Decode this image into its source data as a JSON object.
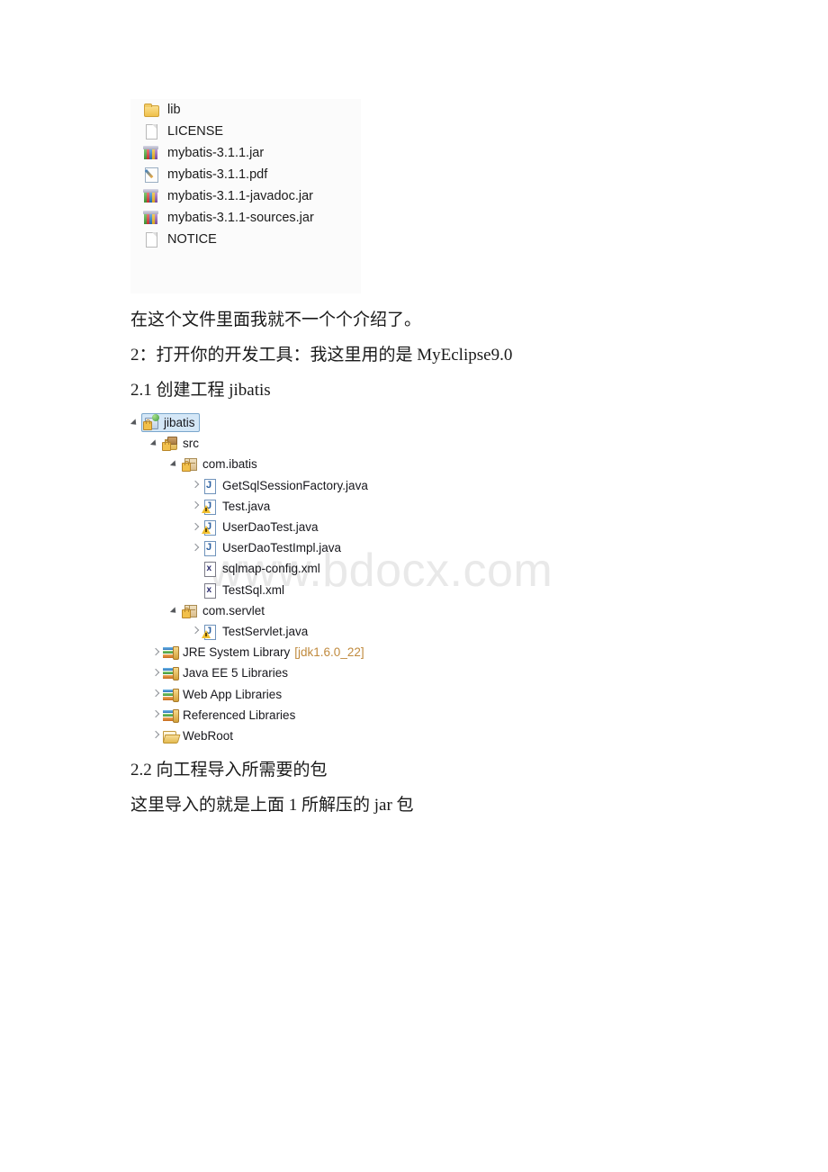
{
  "watermark": {
    "text": "www.bdocx.com"
  },
  "file_list": {
    "items": [
      {
        "name": "lib",
        "icon": "folder-icon",
        "type": "folder"
      },
      {
        "name": "LICENSE",
        "icon": "document-icon",
        "type": "file"
      },
      {
        "name": "mybatis-3.1.1.jar",
        "icon": "archive-icon",
        "type": "jar"
      },
      {
        "name": "mybatis-3.1.1.pdf",
        "icon": "pdf-icon",
        "type": "pdf"
      },
      {
        "name": "mybatis-3.1.1-javadoc.jar",
        "icon": "archive-icon",
        "type": "jar"
      },
      {
        "name": "mybatis-3.1.1-sources.jar",
        "icon": "archive-icon",
        "type": "jar"
      },
      {
        "name": "NOTICE",
        "icon": "document-icon",
        "type": "file"
      }
    ]
  },
  "paragraphs": {
    "intro": "在这个文件里面我就不一个个介绍了。",
    "step2": "2：打开你的开发工具：我这里用的是 MyEclipse9.0",
    "step2_1": "2.1 创建工程 jibatis",
    "step2_2": "2.2 向工程导入所需要的包",
    "step2_2_body": "这里导入的就是上面 1 所解压的 jar 包"
  },
  "project_tree": {
    "nodes": [
      {
        "label": "jibatis",
        "suffix": "",
        "icon": "java-project-icon",
        "indent": 0,
        "arrow": "open",
        "selected": true
      },
      {
        "label": "src",
        "suffix": "",
        "icon": "source-folder-icon",
        "indent": 1,
        "arrow": "open",
        "selected": false
      },
      {
        "label": "com.ibatis",
        "suffix": "",
        "icon": "package-icon",
        "indent": 2,
        "arrow": "open",
        "selected": false
      },
      {
        "label": "GetSqlSessionFactory.java",
        "suffix": "",
        "icon": "java-file-icon",
        "indent": 3,
        "arrow": "closed",
        "selected": false
      },
      {
        "label": "Test.java",
        "suffix": "",
        "icon": "java-file-warning-icon",
        "indent": 3,
        "arrow": "closed",
        "selected": false
      },
      {
        "label": "UserDaoTest.java",
        "suffix": "",
        "icon": "java-file-warning-icon",
        "indent": 3,
        "arrow": "closed",
        "selected": false
      },
      {
        "label": "UserDaoTestImpl.java",
        "suffix": "",
        "icon": "java-file-icon",
        "indent": 3,
        "arrow": "closed",
        "selected": false
      },
      {
        "label": "sqlmap-config.xml",
        "suffix": "",
        "icon": "xml-file-icon",
        "indent": 3,
        "arrow": "none",
        "selected": false
      },
      {
        "label": "TestSql.xml",
        "suffix": "",
        "icon": "xml-file-icon",
        "indent": 3,
        "arrow": "none",
        "selected": false
      },
      {
        "label": "com.servlet",
        "suffix": "",
        "icon": "package-icon",
        "indent": 2,
        "arrow": "open",
        "selected": false
      },
      {
        "label": "TestServlet.java",
        "suffix": "",
        "icon": "java-file-warning-icon",
        "indent": 3,
        "arrow": "closed",
        "selected": false
      },
      {
        "label": "JRE System Library",
        "suffix": "[jdk1.6.0_22]",
        "icon": "library-icon",
        "indent": 1,
        "arrow": "closed",
        "selected": false
      },
      {
        "label": "Java EE 5 Libraries",
        "suffix": "",
        "icon": "library-icon",
        "indent": 1,
        "arrow": "closed",
        "selected": false
      },
      {
        "label": "Web App Libraries",
        "suffix": "",
        "icon": "library-icon",
        "indent": 1,
        "arrow": "closed",
        "selected": false
      },
      {
        "label": "Referenced Libraries",
        "suffix": "",
        "icon": "library-icon",
        "indent": 1,
        "arrow": "closed",
        "selected": false
      },
      {
        "label": "WebRoot",
        "suffix": "",
        "icon": "open-folder-icon",
        "indent": 1,
        "arrow": "closed",
        "selected": false
      }
    ]
  },
  "colors": {
    "selection_bg": "#d4e7f7",
    "selection_border": "#7ba7cc",
    "suffix_text": "#c08a3e",
    "watermark": "#e9e9e9",
    "panel_bg": "#fbfbfb",
    "text": "#1a1a1a"
  }
}
